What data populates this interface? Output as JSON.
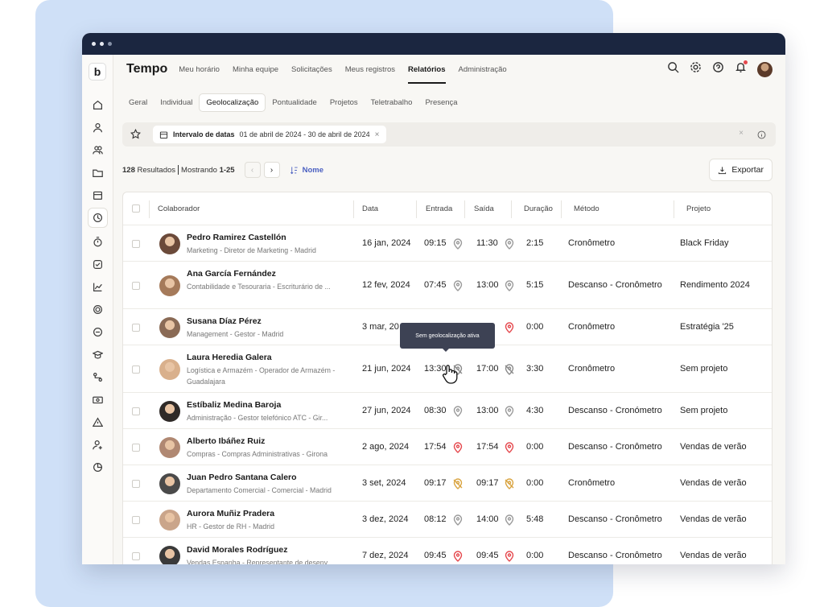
{
  "app": {
    "brand": "Tempo",
    "nav": [
      "Meu horário",
      "Minha equipe",
      "Solicitações",
      "Meus registros",
      "Relatórios",
      "Administração"
    ],
    "active_nav": "Relatórios"
  },
  "subtabs": [
    "Geral",
    "Individual",
    "Geolocalização",
    "Pontualidade",
    "Projetos",
    "Teletrabalho",
    "Presença"
  ],
  "filter": {
    "label": "Intervalo de datas",
    "value": "01 de abril de 2024 - 30 de abril de 2024"
  },
  "results": {
    "count": "128",
    "count_label": "Resultados",
    "showing_label": "Mostrando",
    "range": "1-25",
    "sort_label": "Nome"
  },
  "export_label": "Exportar",
  "columns": [
    "Colaborador",
    "Data",
    "Entrada",
    "Saída",
    "Duração",
    "Método",
    "Projeto"
  ],
  "tooltip": "Sem geolocalização ativa",
  "rows": [
    {
      "name": "Pedro Ramirez Castellón",
      "role": "Marketing - Diretor de Marketing - Madrid",
      "date": "16 jan, 2024",
      "in": "09:15",
      "out": "11:30",
      "duration": "2:15",
      "method": "Cronômetro",
      "project": "Black Friday"
    },
    {
      "name": "Ana García Fernández",
      "role": "Contabilidade e Tesouraria - Escriturário de ...",
      "date": "12 fev, 2024",
      "in": "07:45",
      "out": "13:00",
      "duration": "5:15",
      "method": "Descanso - Cronômetro",
      "project": "Rendimento 2024"
    },
    {
      "name": "Susana Díaz Pérez",
      "role": "Management - Gestor - Madrid",
      "date": "3 mar, 20",
      "in": "",
      "out": "1",
      "duration": "0:00",
      "method": "Cronômetro",
      "project": "Estratégia '25"
    },
    {
      "name": "Laura Heredia Galera",
      "role": "Logística e Armazém - Operador de Armazém - Guadalajara",
      "date": "21 jun, 2024",
      "in": "13:30",
      "out": "17:00",
      "duration": "3:30",
      "method": "Cronômetro",
      "project": "Sem projeto"
    },
    {
      "name": "Estíbaliz Medina Baroja",
      "role": "Administração - Gestor telefónico ATC - Gir...",
      "date": "27 jun, 2024",
      "in": "08:30",
      "out": "13:00",
      "duration": "4:30",
      "method": "Descanso - Cronómetro",
      "project": "Sem projeto"
    },
    {
      "name": "Alberto Ibáñez Ruiz",
      "role": "Compras - Compras Administrativas - Girona",
      "date": "2 ago, 2024",
      "in": "17:54",
      "out": "17:54",
      "duration": "0:00",
      "method": "Descanso - Cronômetro",
      "project": "Vendas de verão"
    },
    {
      "name": "Juan Pedro Santana Calero",
      "role": "Departamento Comercial - Comercial - Madrid",
      "date": "3 set, 2024",
      "in": "09:17",
      "out": "09:17",
      "duration": "0:00",
      "method": "Cronômetro",
      "project": "Vendas de verão"
    },
    {
      "name": "Aurora Muñiz Pradera",
      "role": "HR - Gestor de RH - Madrid",
      "date": "3 dez, 2024",
      "in": "08:12",
      "out": "14:00",
      "duration": "5:48",
      "method": "Descanso - Cronômetro",
      "project": "Vendas de verão"
    },
    {
      "name": "David Morales Rodríguez",
      "role": "Vendas Espanha - Representante de desenv...",
      "date": "7 dez, 2024",
      "in": "09:45",
      "out": "09:45",
      "duration": "0:00",
      "method": "Descanso - Cronômetro",
      "project": "Vendas de verão"
    }
  ],
  "colors": {
    "pin_ok": "#9a9a9a",
    "pin_bad": "#e5484d",
    "pin_off": "#d9a441",
    "accent": "#4a5fc1"
  }
}
